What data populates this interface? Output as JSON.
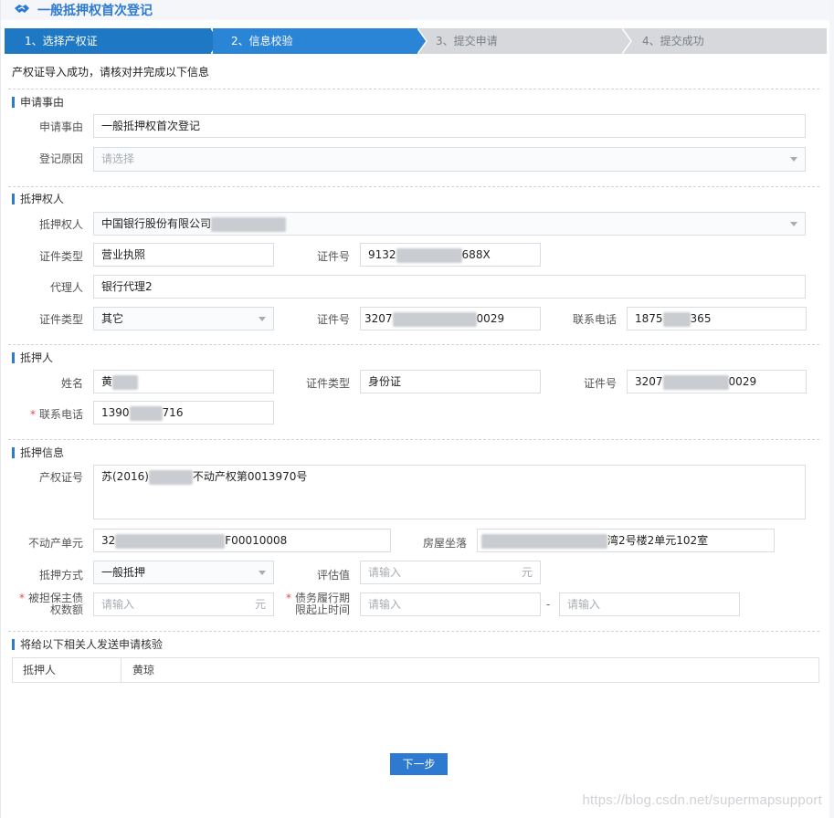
{
  "header": {
    "title": "一般抵押权首次登记"
  },
  "steps": [
    {
      "label": "1、选择产权证",
      "state": "done"
    },
    {
      "label": "2、信息校验",
      "state": "current"
    },
    {
      "label": "3、提交申请",
      "state": "todo"
    },
    {
      "label": "4、提交成功",
      "state": "todo"
    }
  ],
  "notice": "产权证导入成功，请核对并完成以下信息",
  "sections": {
    "reason": {
      "title": "申请事由",
      "apply_reason_label": "申请事由",
      "apply_reason_value": "一般抵押权首次登记",
      "register_reason_label": "登记原因",
      "register_reason_placeholder": "请选择"
    },
    "mortgagee": {
      "title": "抵押权人",
      "name_label": "抵押权人",
      "name_value": "中国银行股份有限公司",
      "cert_type_label": "证件类型",
      "cert_type_value": "营业执照",
      "cert_no_label": "证件号",
      "cert_no_prefix": "9132",
      "cert_no_suffix": "688X",
      "agent_label": "代理人",
      "agent_value": "银行代理2",
      "agent_cert_type_label": "证件类型",
      "agent_cert_type_value": "其它",
      "agent_cert_no_label": "证件号",
      "agent_cert_no_prefix": "3207",
      "agent_cert_no_suffix": "0029",
      "phone_label": "联系电话",
      "phone_prefix": "1875",
      "phone_suffix": "365"
    },
    "mortgagor": {
      "title": "抵押人",
      "name_label": "姓名",
      "name_value": "黄",
      "cert_type_label": "证件类型",
      "cert_type_value": "身份证",
      "cert_no_label": "证件号",
      "cert_no_prefix": "3207",
      "cert_no_suffix": "0029",
      "phone_label": "联系电话",
      "phone_prefix": "1390",
      "phone_suffix": "716"
    },
    "mortgage_info": {
      "title": "抵押信息",
      "property_cert_label": "产权证号",
      "property_cert_prefix": "苏(2016)",
      "property_cert_suffix": "不动产权第0013970号",
      "unit_label": "不动产单元",
      "unit_prefix": "32",
      "unit_suffix": "F00010008",
      "location_label": "房屋坐落",
      "location_suffix": "湾2号楼2单元102室",
      "method_label": "抵押方式",
      "method_value": "一般抵押",
      "valuation_label": "评估值",
      "valuation_placeholder": "请输入",
      "valuation_unit": "元",
      "debt_label_line1": "被担保主债",
      "debt_label_line2": "权数额",
      "debt_placeholder": "请输入",
      "debt_unit": "元",
      "period_label_line1": "债务履行期",
      "period_label_line2": "限起止时间",
      "period_start_placeholder": "请输入",
      "period_end_placeholder": "请输入",
      "period_sep": "-"
    },
    "verify": {
      "title": "将给以下相关人发送申请核验",
      "role": "抵押人",
      "person": "黄琼"
    }
  },
  "next_button": "下一步",
  "watermark": "https://blog.csdn.net/supermapsupport",
  "colors": {
    "accent": "#2d7ad0",
    "step_active": "#1e78c4",
    "step_inactive": "#d6d8db",
    "required": "#e64a4a"
  }
}
